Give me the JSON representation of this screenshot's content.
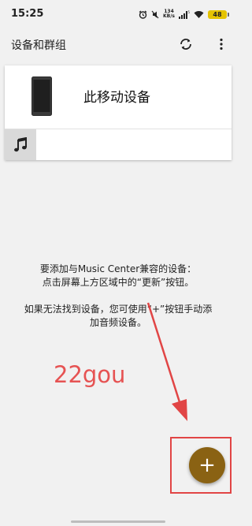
{
  "status_bar": {
    "time": "15:25",
    "network_speed_value": "134",
    "network_speed_unit": "KB/s",
    "battery_level": "48",
    "icons": [
      "alarm-icon",
      "mute-icon",
      "signal-icon",
      "wifi-icon",
      "battery-icon"
    ],
    "battery_color": "#e5c300"
  },
  "app_bar": {
    "title": "设备和群组",
    "refresh_icon": "refresh-icon",
    "more_icon": "more-vert-icon"
  },
  "device_card": {
    "device_name": "此移动设备",
    "device_icon": "phone-icon",
    "music_icon": "music-note-icon"
  },
  "info": {
    "line1": "要添加与Music Center兼容的设备：",
    "line2": "点击屏幕上方区域中的“更新”按钮。",
    "line3": "如果无法找到设备，您可使用“+”按钮手动添",
    "line4": "加音频设备。"
  },
  "watermark": {
    "text": "22gou",
    "color": "#e65353"
  },
  "fab": {
    "label": "+",
    "color": "#8a6213"
  },
  "annotation": {
    "color": "#e14545"
  }
}
